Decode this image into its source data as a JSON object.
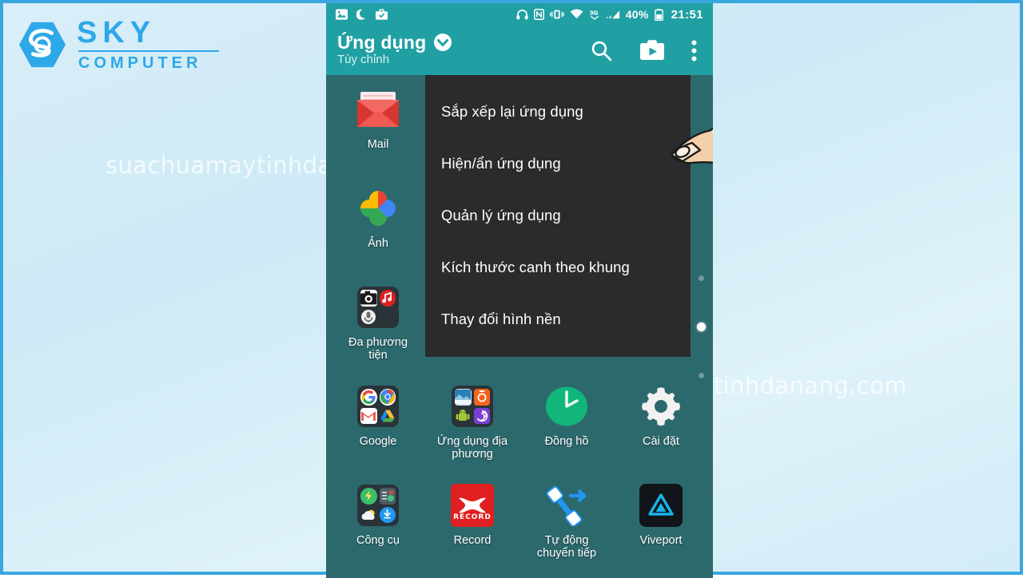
{
  "brand": {
    "name_top": "SKY",
    "name_bottom": "COMPUTER",
    "accent": "#2da8e8"
  },
  "watermarks": {
    "left": "suachuamaytinhdanang.com",
    "right": "suachuamaytinhdanang.com"
  },
  "phone": {
    "status_bar": {
      "icons_left": [
        "image-icon",
        "moon-icon",
        "briefcase-check-icon"
      ],
      "icons_right": [
        "headphones-icon",
        "nfc-icon",
        "vibrate-icon",
        "wifi-icon",
        "3g-icon",
        "signal-icon"
      ],
      "battery_percent": "40%",
      "battery_icon": "battery-icon",
      "time": "21:51"
    },
    "app_bar": {
      "title": "Ứng dụng",
      "subtitle": "Tùy chỉnh",
      "dropdown_icon": "chevron-down-circle-icon",
      "actions": [
        "search-icon",
        "play-store-icon",
        "overflow-menu-icon"
      ]
    },
    "menu": {
      "items": [
        {
          "label": "Sắp xếp lại ứng dụng"
        },
        {
          "label": "Hiện/ẩn ứng dụng"
        },
        {
          "label": "Quản lý ứng dụng"
        },
        {
          "label": "Kích thước canh theo khung"
        },
        {
          "label": "Thay đổi hình nền"
        }
      ]
    },
    "apps": [
      {
        "label": "Mail",
        "icon": "mail-icon"
      },
      {
        "label": "",
        "icon": ""
      },
      {
        "label": "",
        "icon": ""
      },
      {
        "label": "",
        "icon": ""
      },
      {
        "label": "Ảnh",
        "icon": "google-photos-icon"
      },
      {
        "label": "",
        "icon": ""
      },
      {
        "label": "",
        "icon": ""
      },
      {
        "label": "",
        "icon": ""
      },
      {
        "label": "Đa phương tiện",
        "icon": "media-folder-icon"
      },
      {
        "label": "",
        "icon": ""
      },
      {
        "label": "",
        "icon": ""
      },
      {
        "label": "",
        "icon": ""
      },
      {
        "label": "Google",
        "icon": "google-folder-icon"
      },
      {
        "label": "Ứng dụng địa phương",
        "icon": "local-apps-folder-icon"
      },
      {
        "label": "Đồng hồ",
        "icon": "clock-icon"
      },
      {
        "label": "Cài đặt",
        "icon": "settings-gear-icon"
      },
      {
        "label": "Công cụ",
        "icon": "tools-folder-icon"
      },
      {
        "label": "Record",
        "icon": "record-icon"
      },
      {
        "label": "Tự động chuyển tiếp",
        "icon": "call-forward-icon"
      },
      {
        "label": "Viveport",
        "icon": "viveport-icon"
      }
    ],
    "page_indicator": {
      "total": 3,
      "active_index": 1
    },
    "colors": {
      "status_bar": "#21a0a4",
      "app_bar": "#21a0a4",
      "drawer_background": "#2c696d",
      "menu_background": "#2b2b2b",
      "menu_text": "#ffffff"
    }
  }
}
